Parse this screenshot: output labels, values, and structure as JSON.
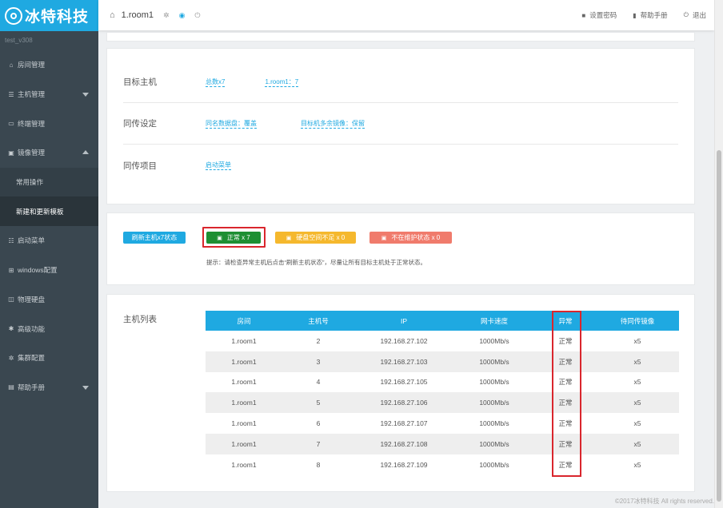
{
  "brand": {
    "name": "冰特科技"
  },
  "sidebar": {
    "version": "test_v308",
    "items": [
      {
        "label": "房间管理",
        "icon": "home-icon"
      },
      {
        "label": "主机管理",
        "icon": "list-icon",
        "caret": "down"
      },
      {
        "label": "终端管理",
        "icon": "terminal-icon"
      },
      {
        "label": "镜像管理",
        "icon": "image-icon",
        "caret": "up"
      },
      {
        "label": "常用操作",
        "sub": true
      },
      {
        "label": "新建和更新模板",
        "sub": true,
        "active": true
      },
      {
        "label": "启动菜单",
        "icon": "menu-icon"
      },
      {
        "label": "windows配置",
        "icon": "windows-icon"
      },
      {
        "label": "物理硬盘",
        "icon": "disk-icon"
      },
      {
        "label": "高级功能",
        "icon": "star-icon"
      },
      {
        "label": "集群配置",
        "icon": "cog-icon"
      },
      {
        "label": "帮助手册",
        "icon": "help-icon",
        "caret": "down"
      }
    ]
  },
  "header": {
    "room": "1.room1",
    "set_password": "设置密码",
    "help_manual": "帮助手册",
    "logout": "退出"
  },
  "settings": {
    "target_host": {
      "label": "目标主机",
      "total": "总数x7",
      "room": "1.room1：7"
    },
    "sync_settings": {
      "label": "同传设定",
      "same_name": "同名数据盘：覆盖",
      "extra_image": "目标机多余镜像：保留"
    },
    "sync_items": {
      "label": "同传项目",
      "boot_menu": "启动菜单"
    }
  },
  "status": {
    "refresh": "刷新主机x7状态",
    "normal": "正常 x 7",
    "disk_insufficient": "硬盘空间不足 x 0",
    "not_maintenance": "不在维护状态 x 0",
    "tip": "提示：请检查异常主机后点击“刷新主机状态”，尽量让所有目标主机处于正常状态。"
  },
  "hosts": {
    "label": "主机列表",
    "columns": [
      "房间",
      "主机号",
      "IP",
      "网卡速度",
      "异常",
      "待同传镜像"
    ],
    "rows": [
      [
        "1.room1",
        "2",
        "192.168.27.102",
        "1000Mb/s",
        "正常",
        "x5"
      ],
      [
        "1.room1",
        "3",
        "192.168.27.103",
        "1000Mb/s",
        "正常",
        "x5"
      ],
      [
        "1.room1",
        "4",
        "192.168.27.105",
        "1000Mb/s",
        "正常",
        "x5"
      ],
      [
        "1.room1",
        "5",
        "192.168.27.106",
        "1000Mb/s",
        "正常",
        "x5"
      ],
      [
        "1.room1",
        "6",
        "192.168.27.107",
        "1000Mb/s",
        "正常",
        "x5"
      ],
      [
        "1.room1",
        "7",
        "192.168.27.108",
        "1000Mb/s",
        "正常",
        "x5"
      ],
      [
        "1.room1",
        "8",
        "192.168.27.109",
        "1000Mb/s",
        "正常",
        "x5"
      ]
    ]
  },
  "footer": {
    "copyright": "©2017冰特科技 All rights reserved."
  },
  "colors": {
    "accent": "#1fa9e1",
    "sidebar": "#3a4750",
    "ok": "#1e8f33",
    "warn": "#f5b82d",
    "danger": "#f07b6c",
    "highlight": "#d9262d"
  }
}
